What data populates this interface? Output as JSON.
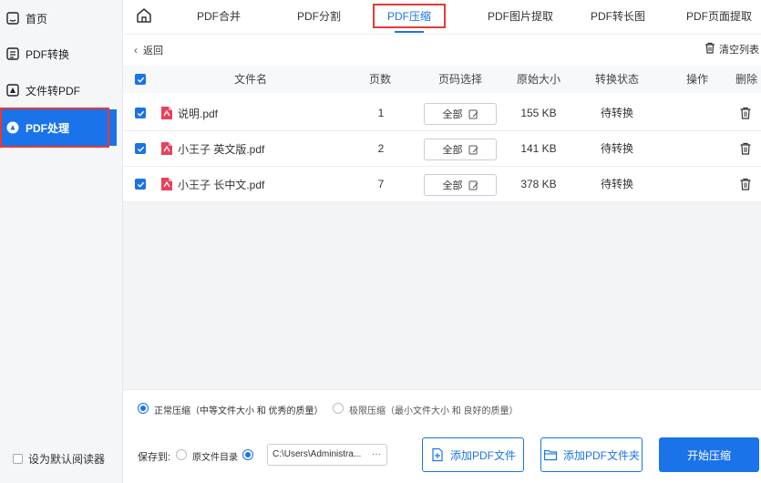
{
  "sidebar": {
    "items": [
      {
        "label": "首页",
        "icon": "home-icon"
      },
      {
        "label": "PDF转换",
        "icon": "pdf-convert-icon"
      },
      {
        "label": "文件转PDF",
        "icon": "file-to-pdf-icon"
      },
      {
        "label": "PDF处理",
        "icon": "pdf-process-icon"
      }
    ],
    "default_reader": "设为默认阅读器"
  },
  "tabs": [
    {
      "label": "PDF合并"
    },
    {
      "label": "PDF分割"
    },
    {
      "label": "PDF压缩"
    },
    {
      "label": "PDF图片提取"
    },
    {
      "label": "PDF转长图"
    },
    {
      "label": "PDF页面提取"
    }
  ],
  "toolbar": {
    "back_label": "返回",
    "clear_label": "清空列表"
  },
  "table": {
    "headers": {
      "name": "文件名",
      "pages": "页数",
      "page_select": "页码选择",
      "size": "原始大小",
      "status": "转换状态",
      "action": "操作",
      "delete": "删除"
    },
    "rows": [
      {
        "name": "说明.pdf",
        "pages": "1",
        "page_select": "全部",
        "size": "155 KB",
        "status": "待转换"
      },
      {
        "name": "小王子 英文版.pdf",
        "pages": "2",
        "page_select": "全部",
        "size": "141 KB",
        "status": "待转换"
      },
      {
        "name": "小王子 长中文.pdf",
        "pages": "7",
        "page_select": "全部",
        "size": "378 KB",
        "status": "待转换"
      }
    ]
  },
  "compression": {
    "normal": "正常压缩（中等文件大小 和 优秀的质量）",
    "extreme": "极限压缩（最小文件大小 和 良好的质量）"
  },
  "save": {
    "label": "保存到:",
    "original_dir": "原文件目录",
    "path": "C:\\Users\\Administra...",
    "more": "···"
  },
  "buttons": {
    "add_file": "添加PDF文件",
    "add_folder": "添加PDF文件夹",
    "start": "开始压缩"
  },
  "colors": {
    "accent": "#1a73e8",
    "highlight": "#e53935",
    "sidebar_bg": "#f5f6f8",
    "pdf_icon": "#e8415c"
  }
}
